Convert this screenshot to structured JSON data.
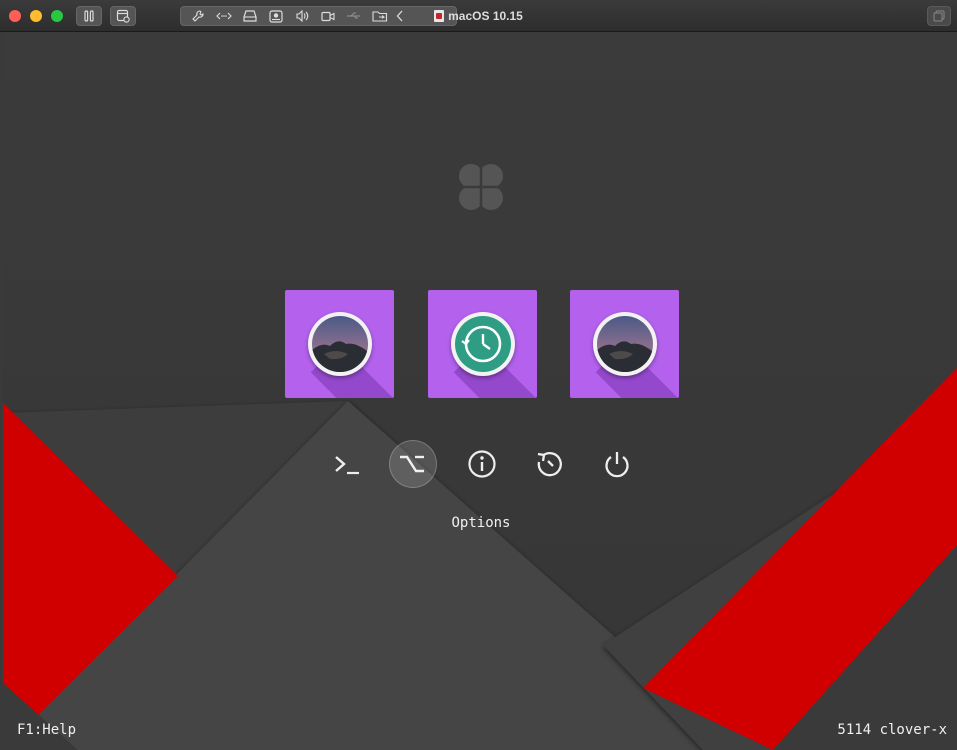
{
  "window": {
    "title": "macOS 10.15"
  },
  "toolbar": {
    "buttons": [
      "pause-icon",
      "snapshot-icon"
    ],
    "devices": [
      "wrench-icon",
      "network-icon",
      "disk-icon",
      "cd-icon",
      "sound-icon",
      "camera-icon",
      "usb-icon",
      "shared-folder-icon",
      "collapse-chevron-icon"
    ]
  },
  "boot_entries": [
    {
      "name": "macos-catalina-volume",
      "icon": "catalina-icon"
    },
    {
      "name": "time-machine-volume",
      "icon": "time-machine-icon"
    },
    {
      "name": "macos-catalina-volume-2",
      "icon": "catalina-icon"
    }
  ],
  "tools": {
    "items": [
      "shell-icon",
      "options-icon",
      "about-icon",
      "reset-icon",
      "shutdown-icon"
    ],
    "selected": "options",
    "selected_label": "Options"
  },
  "footer": {
    "help": "F1:Help",
    "version": "5114 clover-x"
  },
  "colors": {
    "background": "#3c3c3c",
    "accent_red": "#d10000",
    "entry_purple": "#b462ee",
    "time_machine_teal": "#2f9c84"
  }
}
